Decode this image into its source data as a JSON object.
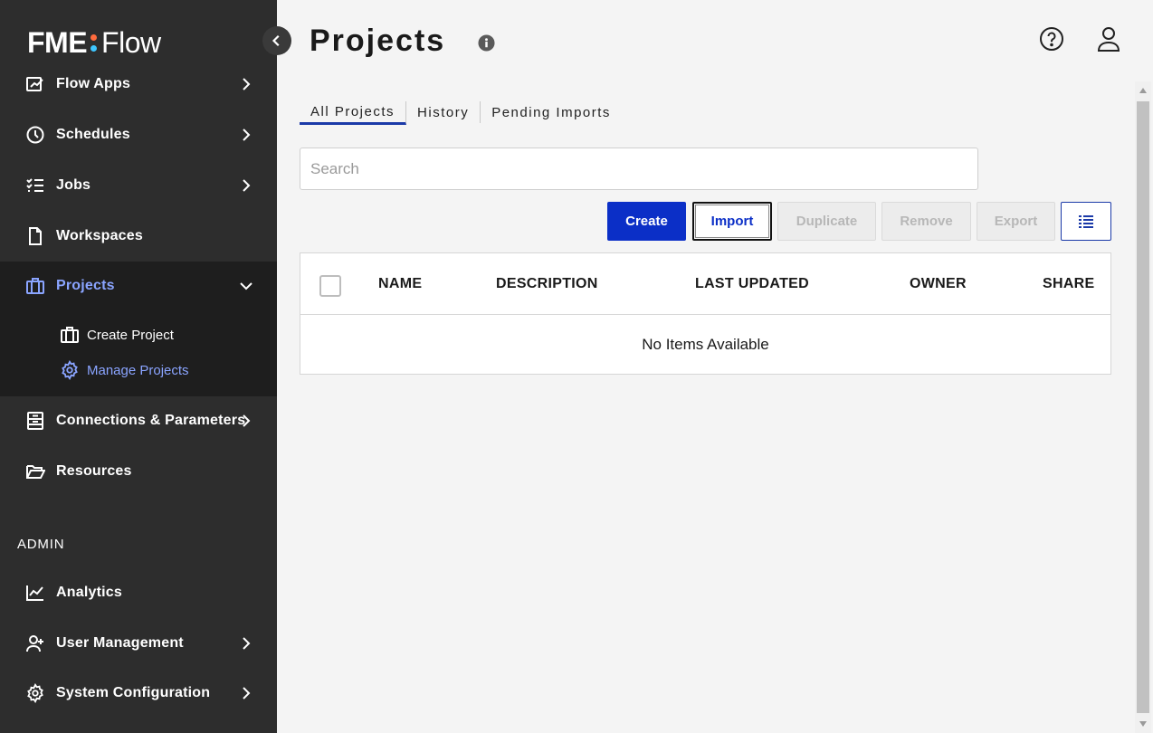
{
  "brand": {
    "name_left": "FME",
    "name_right": "Flow",
    "dot_colors": [
      "#ff6b3d",
      "#3ec6ff"
    ]
  },
  "sidebar": {
    "items": [
      {
        "label": "Flow Apps",
        "icon": "flow-apps-icon",
        "has_chevron": true
      },
      {
        "label": "Schedules",
        "icon": "clock-icon",
        "has_chevron": true
      },
      {
        "label": "Jobs",
        "icon": "checklist-icon",
        "has_chevron": true
      },
      {
        "label": "Workspaces",
        "icon": "document-icon",
        "has_chevron": false
      },
      {
        "label": "Projects",
        "icon": "briefcase-icon",
        "has_chevron": true,
        "expanded": true,
        "active": true
      },
      {
        "label": "Connections & Parameters",
        "icon": "connections-icon",
        "has_chevron": true
      },
      {
        "label": "Resources",
        "icon": "folder-open-icon",
        "has_chevron": false
      }
    ],
    "projects_sub": [
      {
        "label": "Create Project",
        "icon": "briefcase-icon"
      },
      {
        "label": "Manage Projects",
        "icon": "gear-icon",
        "active": true
      }
    ],
    "admin_heading": "ADMIN",
    "admin_items": [
      {
        "label": "Analytics",
        "icon": "chart-line-icon",
        "has_chevron": false
      },
      {
        "label": "User Management",
        "icon": "user-add-icon",
        "has_chevron": true
      },
      {
        "label": "System Configuration",
        "icon": "gear-icon",
        "has_chevron": true
      }
    ]
  },
  "header": {
    "title": "Projects"
  },
  "tabs": [
    {
      "label": "All Projects",
      "active": true
    },
    {
      "label": "History",
      "active": false
    },
    {
      "label": "Pending Imports",
      "active": false
    }
  ],
  "search": {
    "placeholder": "Search",
    "value": ""
  },
  "toolbar": {
    "create_label": "Create",
    "import_label": "Import",
    "duplicate_label": "Duplicate",
    "remove_label": "Remove",
    "export_label": "Export"
  },
  "table": {
    "columns": [
      "NAME",
      "DESCRIPTION",
      "LAST UPDATED",
      "OWNER",
      "SHARE"
    ],
    "empty_text": "No Items Available"
  },
  "colors": {
    "sidebar_bg": "#2d2d2d",
    "sidebar_active_bg": "#1e1e1e",
    "accent": "#0b2fc7",
    "active_text": "#8aa4ff"
  }
}
